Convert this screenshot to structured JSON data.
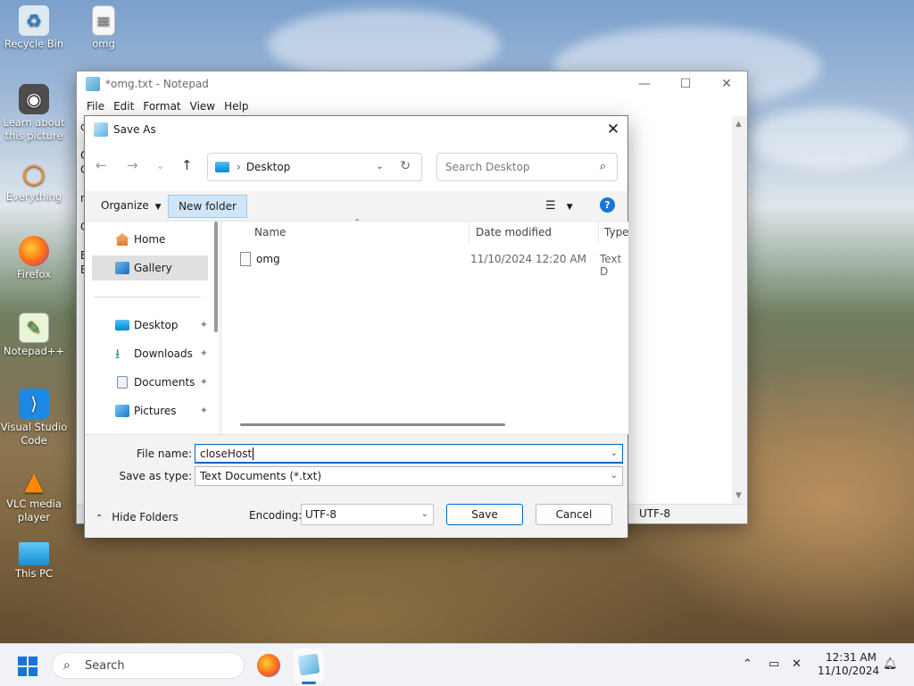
{
  "desktop": {
    "icons": [
      {
        "label": "Recycle Bin"
      },
      {
        "label": "omg"
      },
      {
        "label": "Learn about this picture"
      },
      {
        "label": "Everything"
      },
      {
        "label": "Firefox"
      },
      {
        "label": "Notepad++"
      },
      {
        "label": "Visual Studio Code"
      },
      {
        "label": "VLC media player"
      },
      {
        "label": "This PC"
      }
    ]
  },
  "notepad": {
    "title": "*omg.txt - Notepad",
    "menu": [
      "File",
      "Edit",
      "Format",
      "View",
      "Help"
    ],
    "controls": {
      "minimize": "—",
      "maximize": "☐",
      "close": "✕"
    },
    "status_encoding": "UTF-8",
    "peek_lines": [
      "c",
      "",
      "C",
      "C",
      "",
      "n",
      "",
      "C",
      "",
      "E",
      "E"
    ]
  },
  "save_dialog": {
    "title": "Save As",
    "close": "✕",
    "address": {
      "location": "Desktop"
    },
    "search_placeholder": "Search Desktop",
    "toolbar": {
      "organize": "Organize",
      "new_folder": "New folder"
    },
    "nav": [
      {
        "label": "Home"
      },
      {
        "label": "Gallery"
      },
      {
        "label": "Desktop"
      },
      {
        "label": "Downloads"
      },
      {
        "label": "Documents"
      },
      {
        "label": "Pictures"
      }
    ],
    "columns": {
      "name": "Name",
      "date": "Date modified",
      "type": "Type"
    },
    "files": [
      {
        "name": "omg",
        "date": "11/10/2024 12:20 AM",
        "type": "Text D"
      }
    ],
    "file_name_label": "File name:",
    "file_name_value": "closeHost",
    "save_type_label": "Save as type:",
    "save_type_value": "Text Documents (*.txt)",
    "hide_folders": "Hide Folders",
    "encoding_label": "Encoding:",
    "encoding_value": "UTF-8",
    "save_button": "Save",
    "cancel_button": "Cancel"
  },
  "taskbar": {
    "search_label": "Search",
    "time": "12:31 AM",
    "date": "11/10/2024"
  },
  "colors": {
    "accent": "#0067c0",
    "selection": "#cfe6f8",
    "start": "#1a73d9"
  }
}
